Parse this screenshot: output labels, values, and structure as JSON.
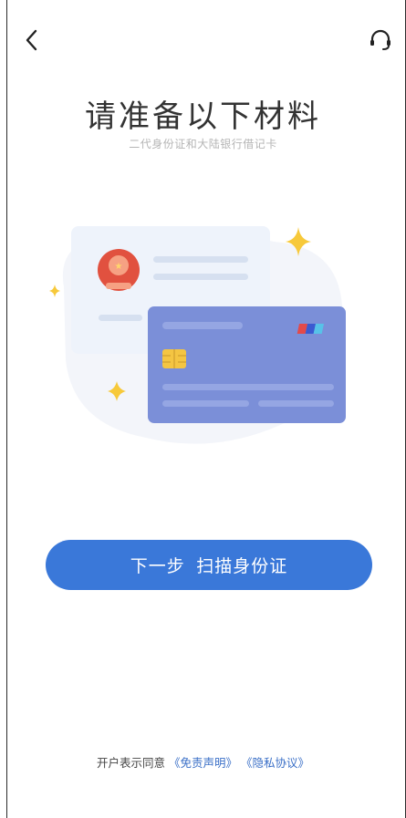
{
  "icons": {
    "back": "chevron-left-icon",
    "service": "headset-icon"
  },
  "header": {
    "title": "请准备以下材料",
    "subtitle": "二代身份证和大陆银行借记卡"
  },
  "illustration": {
    "id_card_color": "#eef3fb",
    "bank_card_color": "#7b8fd8",
    "emblem_color": "#e1513f",
    "chip_color": "#f4c542",
    "sparkle_color": "#f7c93a"
  },
  "action": {
    "next_label": "下一步",
    "scan_label": "扫描身份证",
    "color": "#3a78d9"
  },
  "agreement": {
    "prefix": "开户表示同意",
    "disclaimer_link": "《免责声明》",
    "privacy_link": "《隐私协议》"
  }
}
